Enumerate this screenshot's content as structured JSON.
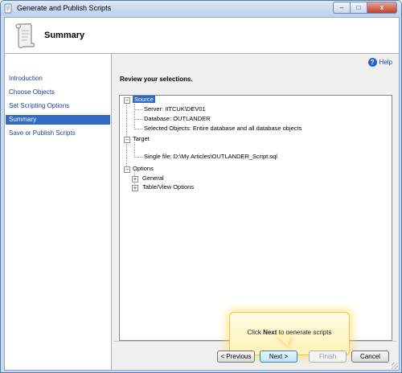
{
  "window": {
    "title": "Generate and Publish Scripts",
    "controls": {
      "minimize": "–",
      "maximize": "□",
      "close": "x"
    }
  },
  "header": {
    "title": "Summary",
    "icon": "scroll-icon"
  },
  "nav": {
    "items": [
      {
        "label": "Introduction"
      },
      {
        "label": "Choose Objects"
      },
      {
        "label": "Set Scripting Options"
      },
      {
        "label": "Summary",
        "selected": true
      },
      {
        "label": "Save or Publish Scripts"
      }
    ]
  },
  "help": {
    "label": "Help",
    "icon_glyph": "?"
  },
  "main": {
    "review_label": "Review your selections."
  },
  "tree": {
    "source": {
      "label": "Source",
      "children": [
        "Server: IITCUK\\DEV01",
        "Database: OUTLANDER",
        "Selected Objects: Entire database and all database objects"
      ]
    },
    "target": {
      "label": "Target",
      "children": [
        "Single file: D:\\My Articles\\OUTLANDER_Script.sql"
      ]
    },
    "options": {
      "label": "Options",
      "children": [
        "General",
        "Table/View Options"
      ]
    },
    "expander_expanded": "−",
    "expander_collapsed": "+"
  },
  "callout": {
    "prefix": "Click ",
    "bold": "Next",
    "suffix": " to generate scripts"
  },
  "buttons": {
    "previous": "< Previous",
    "next": "Next >",
    "finish": "Finish",
    "cancel": "Cancel"
  },
  "colors": {
    "selection": "#316ac5",
    "link": "#1f3f93",
    "callout_bg": "#fff3b8"
  }
}
